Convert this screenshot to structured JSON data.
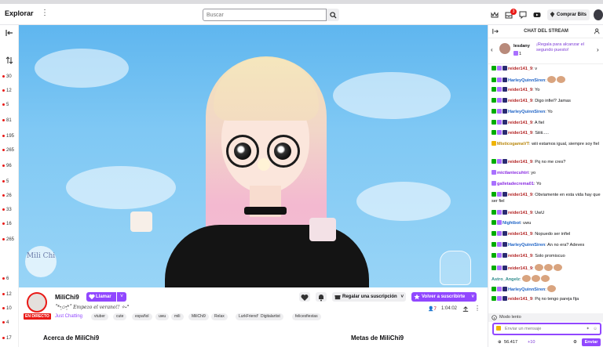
{
  "topnav": {
    "logo": "Explorar",
    "search_placeholder": "Buscar",
    "notif_count": "3",
    "bits_label": "Comprar Bits"
  },
  "left_rail": {
    "counts": [
      "30",
      "12",
      "5",
      "81",
      "195",
      "265",
      "96",
      "5",
      "26",
      "33",
      "16",
      "265",
      "6",
      "12",
      "10",
      "4",
      "17"
    ]
  },
  "video": {
    "logo_text": "Mili Chi"
  },
  "channel": {
    "name": "MiliChi9",
    "follow_label": "Llamar",
    "title": "˚*•̩̩͙✩•̩̩͙*˚ Empezo el verano!! ✧˖°",
    "live_label": "EN DIRECTO",
    "category": "Just Chatting",
    "tags": [
      "vtuber",
      "cute",
      "español",
      "uwu",
      "mili",
      "MiliChi9",
      "Relax",
      "LurkFriendly",
      "Digitalartist",
      "felicesfiestas"
    ],
    "subscribe_label": "Regalar una suscripción",
    "gift_label": "Volver a suscribirte",
    "viewers": "7",
    "uptime": "1:04:02",
    "about_title": "Acerca de MiliChi9",
    "goals_title": "Metas de MiliChi9"
  },
  "chat": {
    "header": "CHAT DEL STREAM",
    "pinned_user": "lesdany",
    "pinned_count": "1",
    "pinned_text": "¡Regala para alcanzar el segundo puesto!",
    "messages": [
      {
        "user": "reider141_9",
        "text": ": v"
      },
      {
        "user": "HarleyQuinnSiren",
        "text": ":"
      },
      {
        "user": "reider141_9",
        "text": ": Yo"
      },
      {
        "user": "reider141_9",
        "text": ": Digo infiel? Jamas"
      },
      {
        "user": "HarleyQuinnSiren",
        "text": ": Yo"
      },
      {
        "user": "reider141_9",
        "text": ": A fiel"
      },
      {
        "user": "reider141_9",
        "text": ": Siiiii....."
      },
      {
        "user": "MisticogamaVT",
        "text": ": wiii estamos igual, siempre soy fiel"
      },
      {
        "user": "reider141_9",
        "text": ": Pq no me cres?"
      },
      {
        "user": "mictlantecuhtri",
        "text": ": yo"
      },
      {
        "user": "galletadecrema01",
        "text": ": Yo"
      },
      {
        "user": "reider141_9",
        "text": ": Obviamente en esta vida hay que ser fiel"
      },
      {
        "user": "reider141_9",
        "text": ": UwU"
      },
      {
        "user": "Nightbot",
        "text": ": uwu"
      },
      {
        "user": "reider141_9",
        "text": ": Nopuedo ser infiel"
      },
      {
        "user": "HarleyQuinnSiren",
        "text": ": An no era? Adeves"
      },
      {
        "user": "reider141_9",
        "text": ": Solo promiscuo"
      },
      {
        "user": "reider141_9",
        "text": ":"
      },
      {
        "user": "Astro_Angelz",
        "text": ":"
      },
      {
        "user": "HarleyQuinnSiren",
        "text": ":"
      },
      {
        "user": "reider141_9",
        "text": ": Pq no tengo pareja fija"
      }
    ],
    "slow_mode": "Modo lento",
    "input_placeholder": "Enviar un mensaje",
    "points": "56.417",
    "points_bonus": "+10",
    "send_label": "Enviar"
  },
  "colors": {
    "brand": "#9147ff",
    "live": "#e91916",
    "mod": "#00ad03"
  }
}
